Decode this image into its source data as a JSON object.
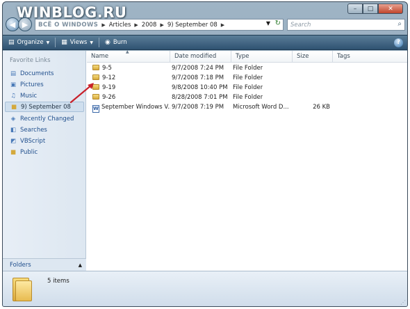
{
  "watermark": "WINBLOG.RU",
  "window_controls": {
    "minimize": "–",
    "maximize": "□",
    "close": "✕"
  },
  "address": {
    "crumbs": [
      "ВСЁ О WINDOWS",
      "Articles",
      "2008",
      "9) September 08"
    ],
    "search_placeholder": "Search"
  },
  "toolbar": {
    "organize": "Organize",
    "views": "Views",
    "burn": "Burn",
    "help": "?"
  },
  "nav": {
    "header": "Favorite Links",
    "items": [
      {
        "label": "Documents",
        "icon": "documents-icon"
      },
      {
        "label": "Pictures",
        "icon": "pictures-icon"
      },
      {
        "label": "Music",
        "icon": "music-icon"
      },
      {
        "label": "9) September 08",
        "icon": "folder-icon",
        "selected": true
      },
      {
        "label": "Recently Changed",
        "icon": "recent-icon"
      },
      {
        "label": "Searches",
        "icon": "search-folder-icon"
      },
      {
        "label": "VBScript",
        "icon": "vbscript-icon"
      },
      {
        "label": "Public",
        "icon": "public-icon"
      }
    ],
    "folders_label": "Folders"
  },
  "columns": [
    "Name",
    "Date modified",
    "Type",
    "Size",
    "Tags"
  ],
  "files": [
    {
      "name": "9-5",
      "date": "9/7/2008 7:24 PM",
      "type": "File Folder",
      "size": "",
      "kind": "folder"
    },
    {
      "name": "9-12",
      "date": "9/7/2008 7:18 PM",
      "type": "File Folder",
      "size": "",
      "kind": "folder"
    },
    {
      "name": "9-19",
      "date": "9/8/2008 10:40 PM",
      "type": "File Folder",
      "size": "",
      "kind": "folder"
    },
    {
      "name": "9-26",
      "date": "8/28/2008 7:01 PM",
      "type": "File Folder",
      "size": "",
      "kind": "folder"
    },
    {
      "name": "September Windows V...",
      "date": "9/7/2008 7:19 PM",
      "type": "Microsoft Word D...",
      "size": "26 KB",
      "kind": "doc"
    }
  ],
  "status": {
    "item_count": "5 items"
  },
  "colors": {
    "toolbar": "#3e6383",
    "nav_bg": "#e4ecf5",
    "link": "#1f4e8c",
    "arrow": "#c8202a"
  }
}
